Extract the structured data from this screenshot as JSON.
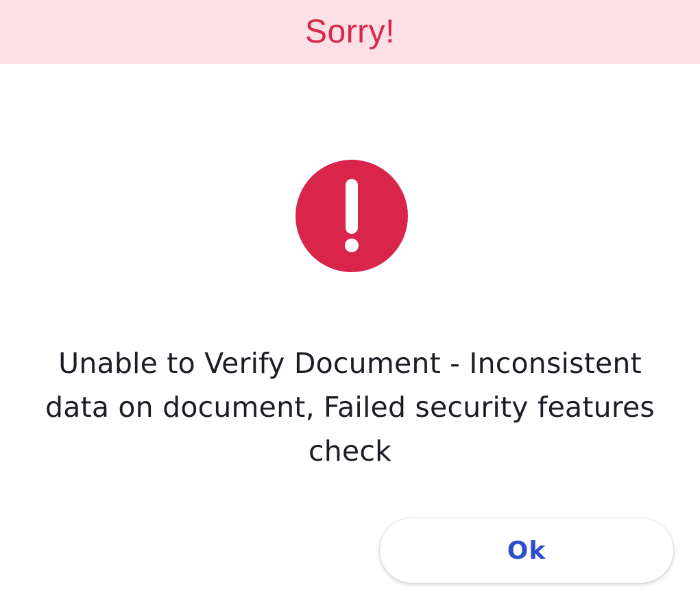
{
  "dialog": {
    "title": "Sorry!",
    "message": "Unable to Verify Document - Inconsistent data on document, Failed security features check",
    "icon": "alert-circle-icon",
    "ok_label": "Ok"
  },
  "colors": {
    "header_background": "#fde0e5",
    "title_text": "#d9254a",
    "icon_fill": "#d9254a",
    "icon_glyph": "#ffffff",
    "message_text": "#1b1d24",
    "ok_text": "#2d4fc9"
  }
}
